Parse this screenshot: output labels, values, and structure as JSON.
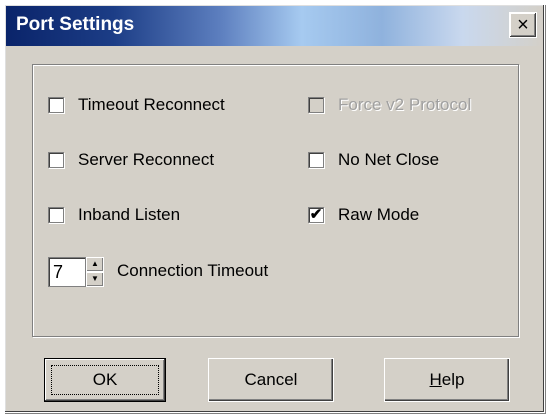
{
  "window": {
    "title": "Port Settings",
    "close_glyph": "×"
  },
  "options": {
    "timeout_reconnect": {
      "label": "Timeout Reconnect",
      "checked": false
    },
    "force_v2_protocol": {
      "label": "Force v2 Protocol",
      "checked": false,
      "enabled": false
    },
    "server_reconnect": {
      "label": "Server Reconnect",
      "checked": false
    },
    "no_net_close": {
      "label": "No Net Close",
      "checked": false
    },
    "inband_listen": {
      "label": "Inband Listen",
      "checked": false
    },
    "raw_mode": {
      "label": "Raw Mode",
      "checked": true,
      "check_glyph": "✔"
    }
  },
  "connection_timeout": {
    "value": "7",
    "label": "Connection Timeout",
    "up_glyph": "▲",
    "down_glyph": "▼"
  },
  "buttons": {
    "ok": "OK",
    "cancel": "Cancel",
    "help_first": "H",
    "help_rest": "elp"
  }
}
